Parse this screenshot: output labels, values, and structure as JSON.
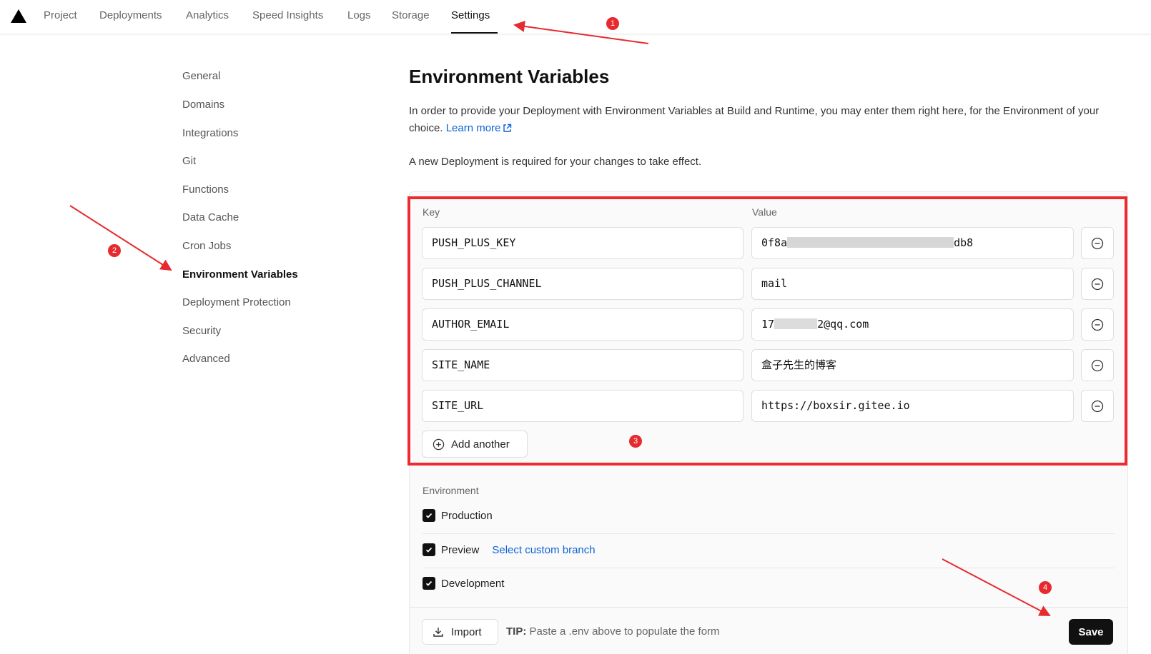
{
  "topnav": {
    "tabs": [
      {
        "label": "Project"
      },
      {
        "label": "Deployments"
      },
      {
        "label": "Analytics"
      },
      {
        "label": "Speed Insights"
      },
      {
        "label": "Logs"
      },
      {
        "label": "Storage"
      },
      {
        "label": "Settings",
        "active": true
      }
    ]
  },
  "sidebar": {
    "items": [
      {
        "label": "General"
      },
      {
        "label": "Domains"
      },
      {
        "label": "Integrations"
      },
      {
        "label": "Git"
      },
      {
        "label": "Functions"
      },
      {
        "label": "Data Cache"
      },
      {
        "label": "Cron Jobs"
      },
      {
        "label": "Environment Variables",
        "active": true
      },
      {
        "label": "Deployment Protection"
      },
      {
        "label": "Security"
      },
      {
        "label": "Advanced"
      }
    ]
  },
  "main": {
    "title": "Environment Variables",
    "description": "In order to provide your Deployment with Environment Variables at Build and Runtime, you may enter them right here, for the Environment of your choice.",
    "learn_more": "Learn more",
    "note": "A new Deployment is required for your changes to take effect."
  },
  "form": {
    "key_label": "Key",
    "value_label": "Value",
    "rows": [
      {
        "key": "PUSH_PLUS_KEY",
        "value_prefix": "0f8a",
        "value_suffix": "db8"
      },
      {
        "key": "PUSH_PLUS_CHANNEL",
        "value": "mail"
      },
      {
        "key": "AUTHOR_EMAIL",
        "value_prefix": "17",
        "value_suffix": "2@qq.com"
      },
      {
        "key": "SITE_NAME",
        "value": "盒子先生的博客"
      },
      {
        "key": "SITE_URL",
        "value": "https://boxsir.gitee.io"
      }
    ],
    "add_another": "Add another"
  },
  "environment": {
    "label": "Environment",
    "options": [
      {
        "label": "Production",
        "checked": true
      },
      {
        "label": "Preview",
        "checked": true,
        "link": "Select custom branch"
      },
      {
        "label": "Development",
        "checked": true
      }
    ]
  },
  "footer": {
    "import_label": "Import",
    "tip_prefix": "TIP:",
    "tip_text": "Paste a .env above to populate the form",
    "save_label": "Save"
  },
  "annotations": {
    "badges": [
      "1",
      "2",
      "3",
      "4"
    ],
    "highlight_color": "#ee2a2f"
  },
  "colors": {
    "accent_link": "#0b63d6",
    "primary_button": "#111111",
    "annotation_red": "#e62a2f"
  }
}
